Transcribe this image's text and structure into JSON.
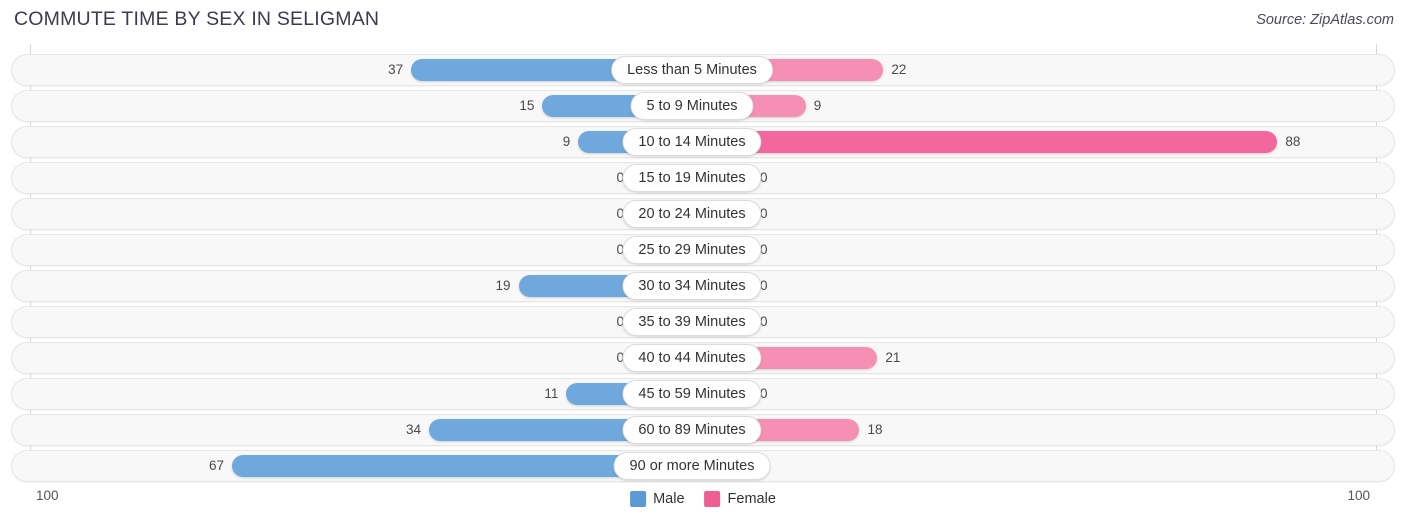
{
  "header": {
    "title": "COMMUTE TIME BY SEX IN SELIGMAN",
    "source": "Source: ZipAtlas.com"
  },
  "axis": {
    "left_tick": "100",
    "right_tick": "100"
  },
  "legend": {
    "items": [
      {
        "label": "Male",
        "color": "#5b9bd5"
      },
      {
        "label": "Female",
        "color": "#ee5e92"
      }
    ]
  },
  "colors": {
    "male_strong": "#6fa8dc",
    "male_light": "#a8c8ec",
    "female_strong": "#f2689c",
    "female_light": "#f590b4",
    "track": "#f8f8f8",
    "track_border": "#e6e6e6"
  },
  "chart_data": {
    "type": "bar",
    "title": "COMMUTE TIME BY SEX IN SELIGMAN",
    "subtitle": "",
    "xlabel": "",
    "ylabel": "",
    "orientation": "horizontal-diverging",
    "grid": false,
    "legend_position": "bottom-center",
    "xlim": [
      100,
      100
    ],
    "axis_ticks": [
      "100",
      "100"
    ],
    "categories": [
      "Less than 5 Minutes",
      "5 to 9 Minutes",
      "10 to 14 Minutes",
      "15 to 19 Minutes",
      "20 to 24 Minutes",
      "25 to 29 Minutes",
      "30 to 34 Minutes",
      "35 to 39 Minutes",
      "40 to 44 Minutes",
      "45 to 59 Minutes",
      "60 to 89 Minutes",
      "90 or more Minutes"
    ],
    "series": [
      {
        "name": "Male",
        "values": [
          37,
          15,
          9,
          0,
          0,
          0,
          19,
          0,
          0,
          11,
          34,
          67
        ]
      },
      {
        "name": "Female",
        "values": [
          22,
          9,
          88,
          0,
          0,
          0,
          0,
          0,
          21,
          0,
          18,
          0
        ]
      }
    ]
  },
  "rows": [
    {
      "label": "Less than 5 Minutes",
      "male": "37",
      "female": "22",
      "male_val": 37,
      "female_val": 22
    },
    {
      "label": "5 to 9 Minutes",
      "male": "15",
      "female": "9",
      "male_val": 15,
      "female_val": 9
    },
    {
      "label": "10 to 14 Minutes",
      "male": "9",
      "female": "88",
      "male_val": 9,
      "female_val": 88
    },
    {
      "label": "15 to 19 Minutes",
      "male": "0",
      "female": "0",
      "male_val": 0,
      "female_val": 0
    },
    {
      "label": "20 to 24 Minutes",
      "male": "0",
      "female": "0",
      "male_val": 0,
      "female_val": 0
    },
    {
      "label": "25 to 29 Minutes",
      "male": "0",
      "female": "0",
      "male_val": 0,
      "female_val": 0
    },
    {
      "label": "30 to 34 Minutes",
      "male": "19",
      "female": "0",
      "male_val": 19,
      "female_val": 0
    },
    {
      "label": "35 to 39 Minutes",
      "male": "0",
      "female": "0",
      "male_val": 0,
      "female_val": 0
    },
    {
      "label": "40 to 44 Minutes",
      "male": "0",
      "female": "21",
      "male_val": 0,
      "female_val": 21
    },
    {
      "label": "45 to 59 Minutes",
      "male": "11",
      "female": "0",
      "male_val": 11,
      "female_val": 0
    },
    {
      "label": "60 to 89 Minutes",
      "male": "34",
      "female": "18",
      "male_val": 34,
      "female_val": 18
    },
    {
      "label": "90 or more Minutes",
      "male": "67",
      "female": "0",
      "male_val": 67,
      "female_val": 0
    }
  ]
}
